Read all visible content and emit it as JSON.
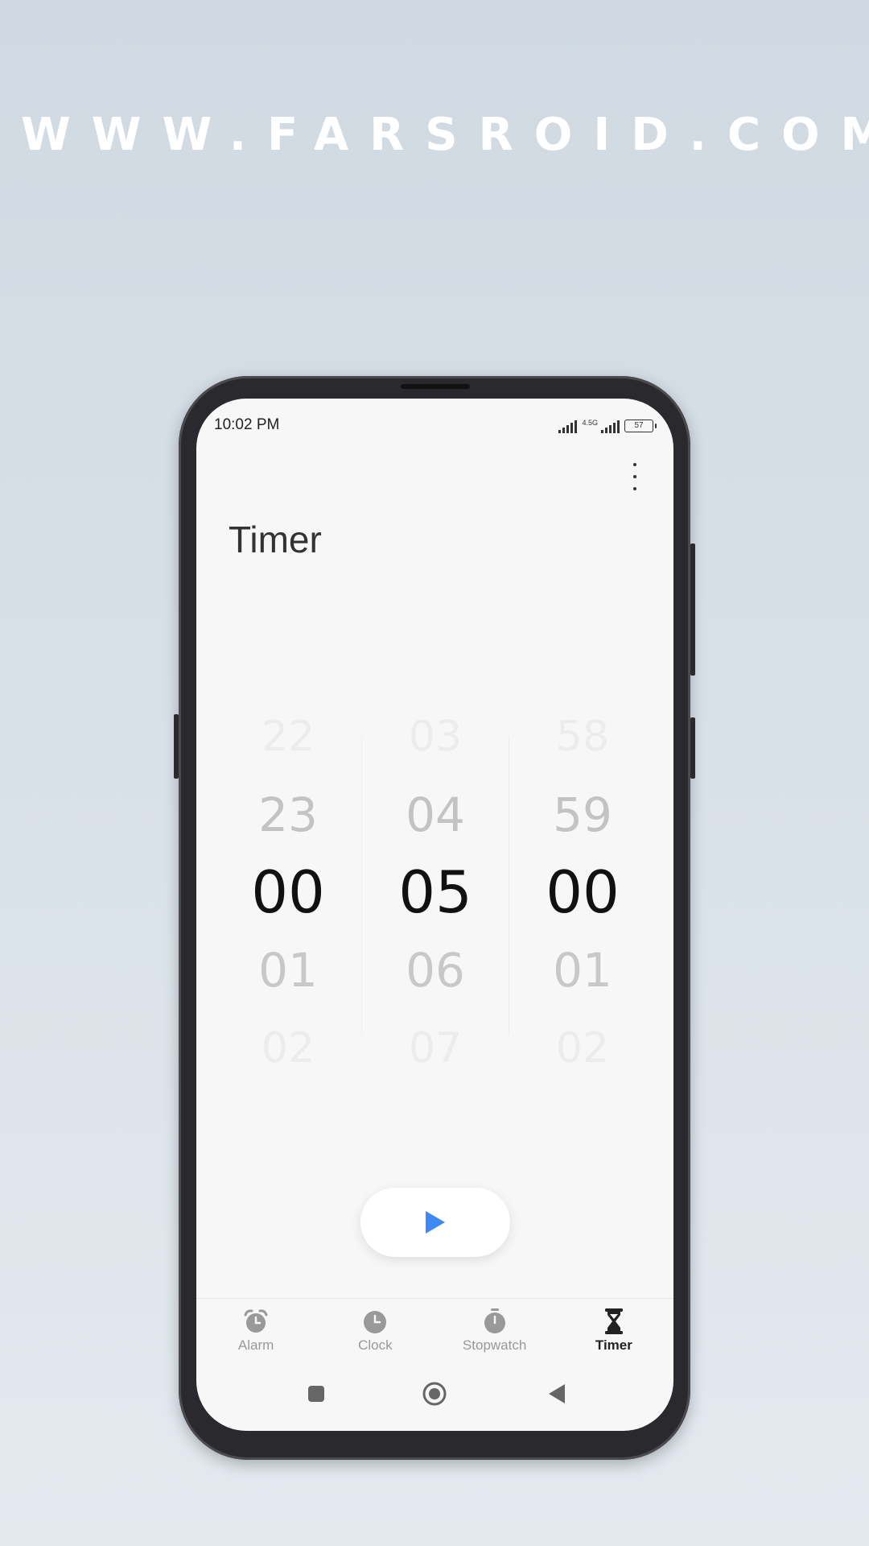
{
  "watermark": "WWW.FARSROID.COM",
  "status_bar": {
    "time": "10:02 PM",
    "network_label": "4.5G",
    "battery": "57"
  },
  "page": {
    "title": "Timer"
  },
  "picker": {
    "hours": [
      "22",
      "23",
      "00",
      "01",
      "02"
    ],
    "minutes": [
      "03",
      "04",
      "05",
      "06",
      "07"
    ],
    "seconds": [
      "58",
      "59",
      "00",
      "01",
      "02"
    ],
    "selected": {
      "hours": "00",
      "minutes": "05",
      "seconds": "00"
    }
  },
  "start_button": {
    "icon": "play-icon",
    "color": "#3d8af7"
  },
  "bottom_nav": {
    "items": [
      {
        "label": "Alarm",
        "icon": "alarm-icon"
      },
      {
        "label": "Clock",
        "icon": "clock-icon"
      },
      {
        "label": "Stopwatch",
        "icon": "stopwatch-icon"
      },
      {
        "label": "Timer",
        "icon": "hourglass-icon",
        "active": true
      }
    ]
  },
  "colors": {
    "accent": "#3d8af7",
    "inactive_icon": "#999999",
    "active_icon": "#222222",
    "background": "#f7f7f7"
  }
}
